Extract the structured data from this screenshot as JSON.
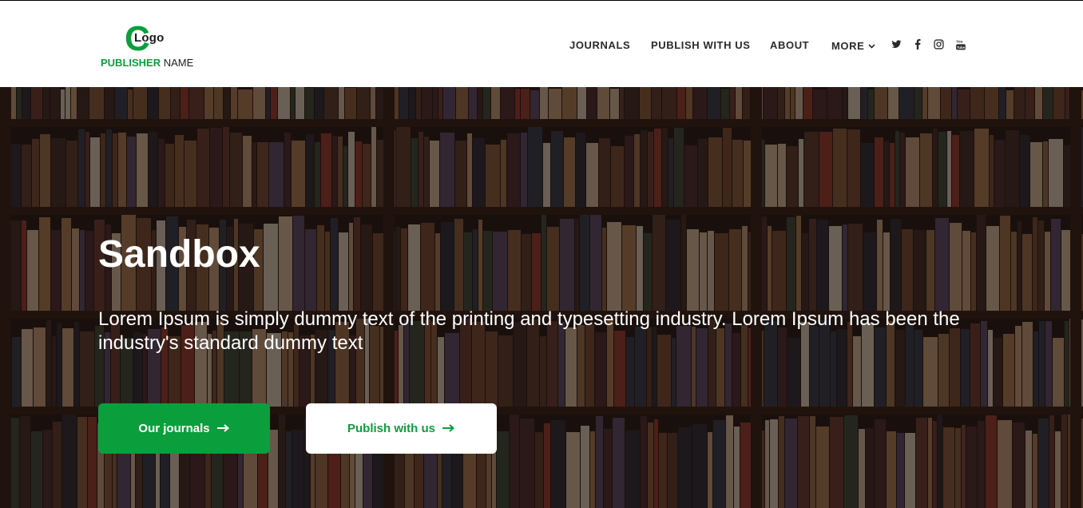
{
  "logo": {
    "letter": "C",
    "word": "Logo",
    "publisher": "PUBLISHER",
    "name": "NAME"
  },
  "nav": {
    "items": [
      {
        "label": "JOURNALS"
      },
      {
        "label": "PUBLISH WITH US"
      },
      {
        "label": "ABOUT"
      },
      {
        "label": "MORE"
      }
    ],
    "social_icons": [
      "twitter-icon",
      "facebook-icon",
      "instagram-icon",
      "youtube-icon"
    ]
  },
  "hero": {
    "title": "Sandbox",
    "description": "Lorem Ipsum is simply dummy text of the printing and typesetting industry. Lorem Ipsum has been the industry's standard dummy text",
    "background": "bookshelf photo",
    "primary_button": {
      "label": "Our journals"
    },
    "secondary_button": {
      "label": "Publish with us"
    }
  },
  "colors": {
    "brand_green": "#0b9e3d",
    "nav_text": "#2a2a2a",
    "white": "#ffffff"
  }
}
